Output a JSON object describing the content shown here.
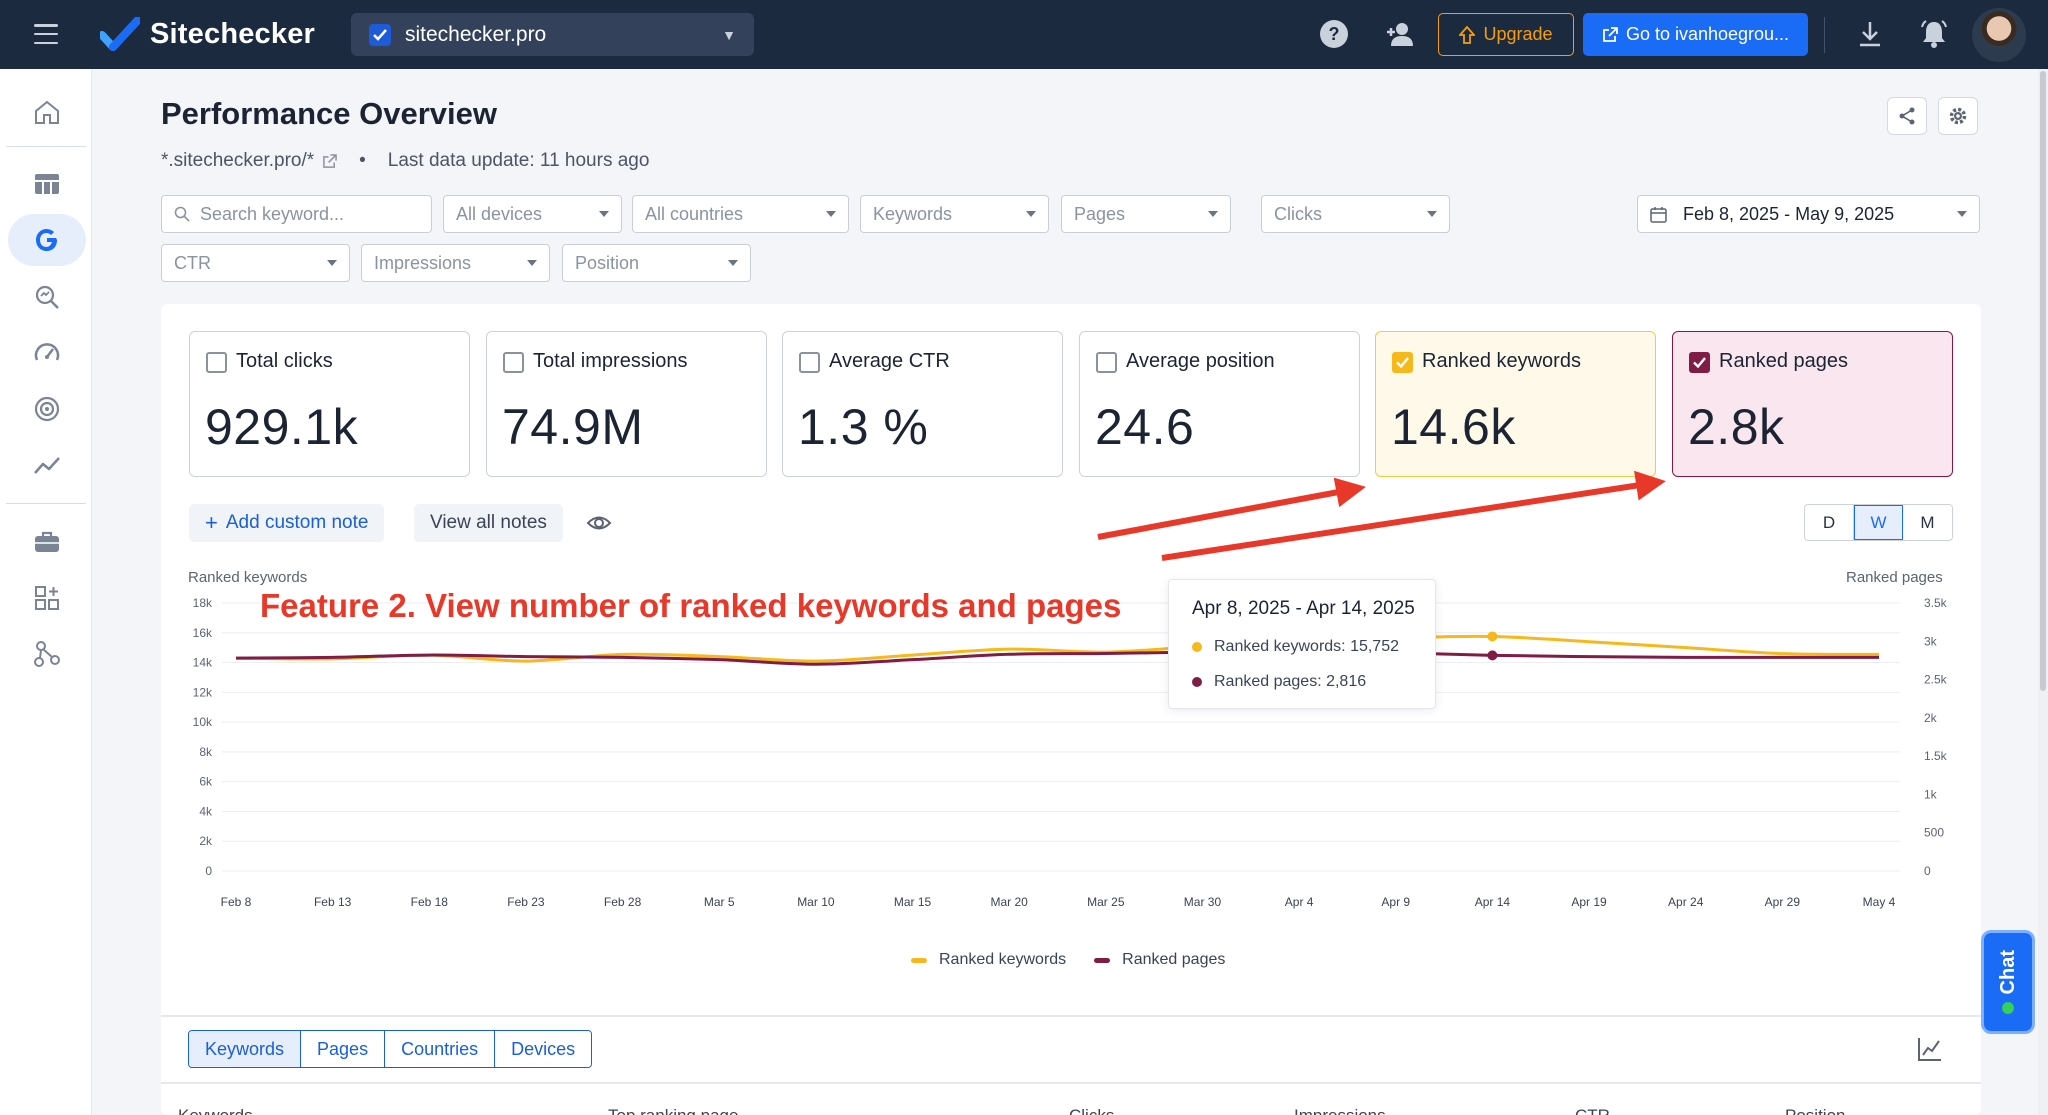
{
  "topbar": {
    "brand": "Sitechecker",
    "site": "sitechecker.pro",
    "upgrade_label": "Upgrade",
    "goto_label": "Go to ivanhoegrou...",
    "icons": [
      "menu-icon",
      "help-icon",
      "add-user-icon",
      "download-icon",
      "bell-icon"
    ]
  },
  "sidebar": {
    "items": [
      "home-icon",
      "table-icon",
      "google-icon",
      "search-analytics-icon",
      "speedometer-icon",
      "target-icon",
      "trend-icon",
      "briefcase-icon",
      "apps-icon",
      "network-icon"
    ],
    "active": "google-icon"
  },
  "header": {
    "title": "Performance Overview",
    "domain": "*.sitechecker.pro/*",
    "bullet": "•",
    "last_update": "Last data update: 11 hours ago"
  },
  "filters": {
    "search_placeholder": "Search keyword...",
    "devices": "All devices",
    "countries": "All countries",
    "keywords": "Keywords",
    "pages": "Pages",
    "clicks": "Clicks",
    "ctr": "CTR",
    "impressions": "Impressions",
    "position": "Position",
    "date_range": "Feb 8, 2025 - May 9, 2025"
  },
  "metrics": [
    {
      "label": "Total clicks",
      "value": "929.1k",
      "checked": false
    },
    {
      "label": "Total impressions",
      "value": "74.9M",
      "checked": false
    },
    {
      "label": "Average CTR",
      "value": "1.3 %",
      "checked": false
    },
    {
      "label": "Average position",
      "value": "24.6",
      "checked": false
    },
    {
      "label": "Ranked keywords",
      "value": "14.6k",
      "checked": true,
      "color": "#f5b91d"
    },
    {
      "label": "Ranked pages",
      "value": "2.8k",
      "checked": true,
      "color": "#7f1d47"
    }
  ],
  "notes": {
    "add_label": "Add custom note",
    "add_prefix": "+",
    "view_label": "View all notes"
  },
  "granularity": {
    "options": [
      "D",
      "W",
      "M"
    ],
    "selected": "W"
  },
  "annotation": "Feature 2. View number of ranked keywords and pages",
  "tooltip": {
    "title": "Apr 8, 2025 - Apr 14, 2025",
    "keywords": "Ranked keywords: 15,752",
    "pages": "Ranked pages: 2,816"
  },
  "chart_data": {
    "type": "line",
    "y_left_label": "Ranked keywords",
    "y_right_label": "Ranked pages",
    "y_left_ticks": [
      "18k",
      "16k",
      "14k",
      "12k",
      "10k",
      "8k",
      "6k",
      "4k",
      "2k",
      "0"
    ],
    "y_right_ticks": [
      "3.5k",
      "3k",
      "2.5k",
      "2k",
      "1.5k",
      "1k",
      "500",
      "0"
    ],
    "ylim_left": [
      0,
      18000
    ],
    "ylim_right": [
      0,
      3500
    ],
    "categories": [
      "Feb 8",
      "Feb 13",
      "Feb 18",
      "Feb 23",
      "Feb 28",
      "Mar 5",
      "Mar 10",
      "Mar 15",
      "Mar 20",
      "Mar 25",
      "Mar 30",
      "Apr 4",
      "Apr 9",
      "Apr 14",
      "Apr 19",
      "Apr 24",
      "Apr 29",
      "May 4"
    ],
    "series": [
      {
        "name": "Ranked keywords",
        "color": "#f5b91d",
        "axis": "left",
        "values": [
          14300,
          14250,
          14500,
          14100,
          14550,
          14400,
          14100,
          14500,
          14900,
          14700,
          15100,
          15400,
          15650,
          15752,
          15400,
          15000,
          14600,
          14550
        ]
      },
      {
        "name": "Ranked pages",
        "color": "#7f1d47",
        "axis": "right",
        "values": [
          2780,
          2790,
          2820,
          2800,
          2790,
          2760,
          2700,
          2760,
          2830,
          2840,
          2860,
          2870,
          2850,
          2816,
          2800,
          2790,
          2790,
          2790
        ]
      }
    ],
    "highlight_index": 13,
    "legend_position": "bottom-center",
    "grid": true
  },
  "table": {
    "tabs": [
      "Keywords",
      "Pages",
      "Countries",
      "Devices"
    ],
    "selected_tab": "Keywords",
    "columns": [
      "Keywords",
      "Top ranking page",
      "Clicks",
      "Impressions",
      "CTR",
      "Position"
    ]
  },
  "chat": {
    "label": "Chat"
  }
}
